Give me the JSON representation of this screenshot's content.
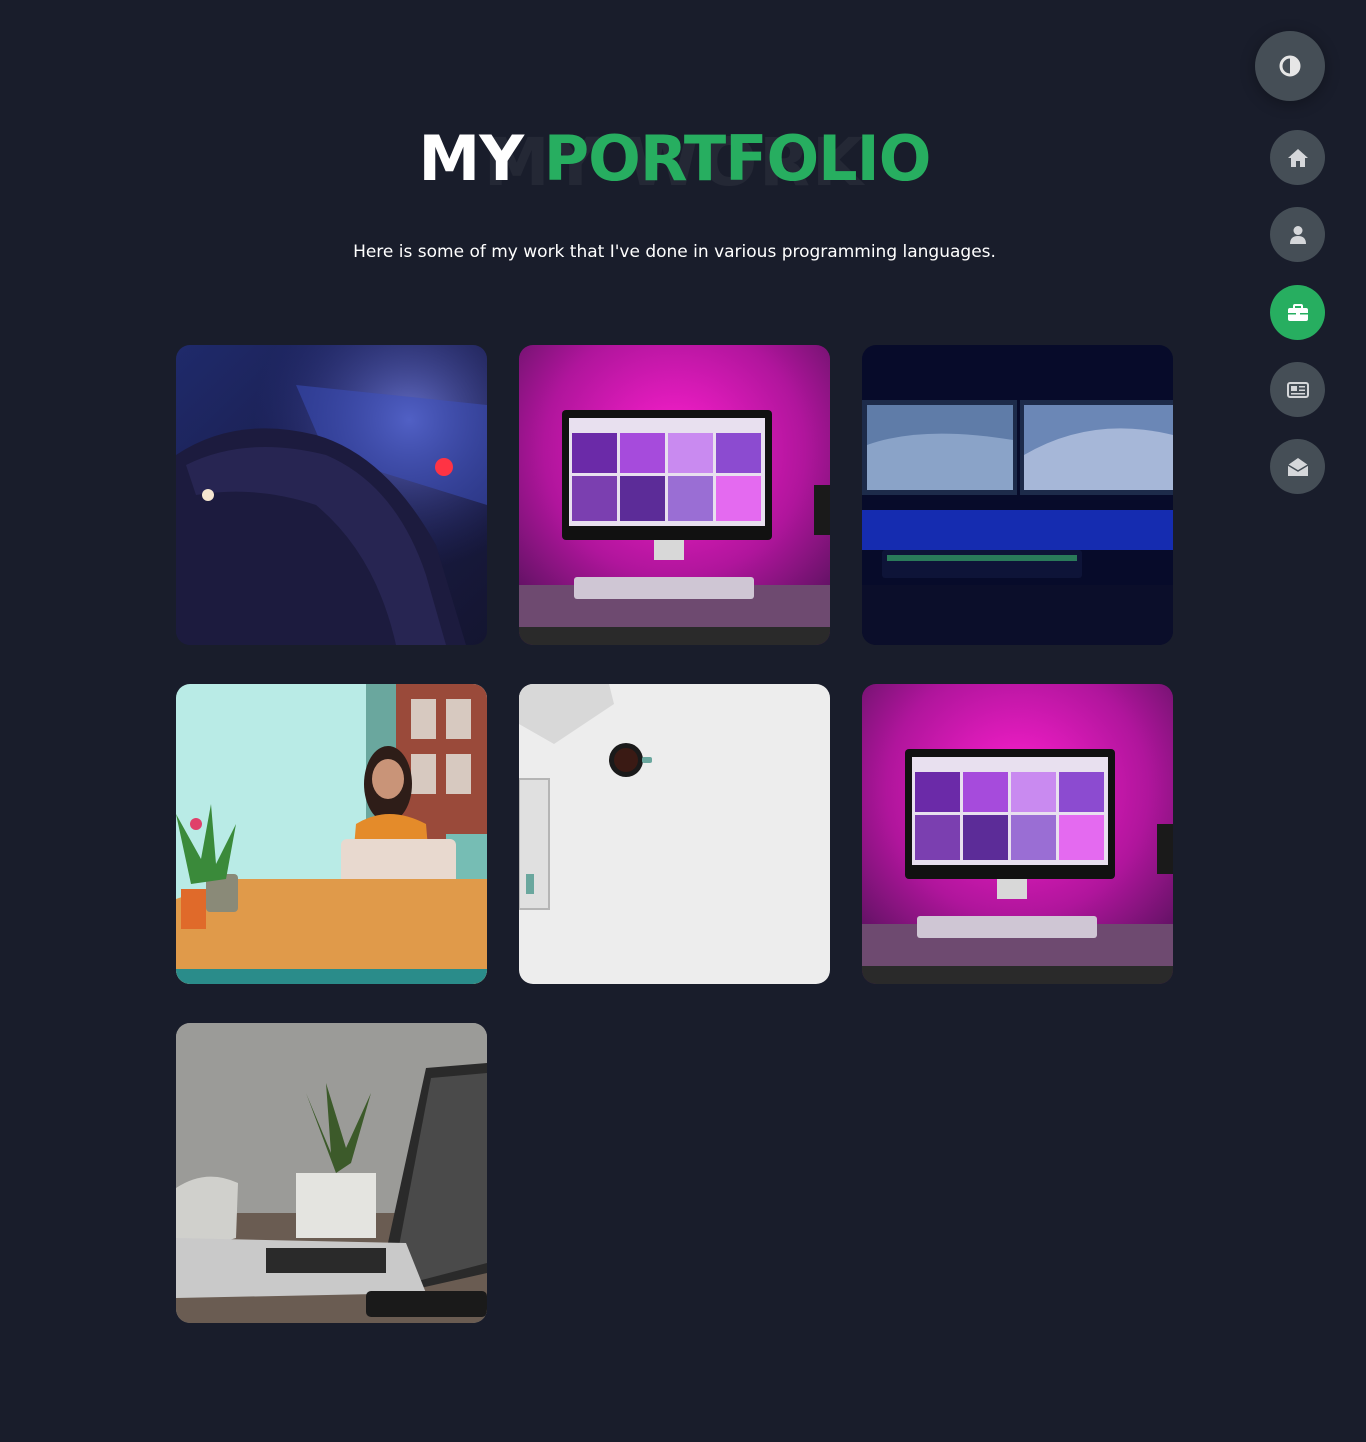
{
  "title": {
    "background_text": "MY WORK",
    "white_part": "MY",
    "green_part": "PORTFOLIO"
  },
  "subtitle": "Here is some of my work that I've done in various programming languages.",
  "colors": {
    "background": "#191d2b",
    "accent": "#27ae60",
    "button": "#454e56"
  },
  "controls": {
    "theme_toggle_icon": "half-circle-contrast-icon",
    "nav_items": [
      {
        "name": "home",
        "icon": "home-icon",
        "active": false
      },
      {
        "name": "about",
        "icon": "user-icon",
        "active": false
      },
      {
        "name": "portfolio",
        "icon": "briefcase-icon",
        "active": true
      },
      {
        "name": "blogs",
        "icon": "newspaper-icon",
        "active": false
      },
      {
        "name": "contact",
        "icon": "envelope-open-icon",
        "active": false
      }
    ]
  },
  "portfolio_items": [
    {
      "image": "hand on backlit keyboard"
    },
    {
      "image": "pink-lit desk with monitor"
    },
    {
      "image": "dual monitor blue desk setup"
    },
    {
      "image": "woman using laptop at table"
    },
    {
      "image": "white desk with coffee cup"
    },
    {
      "image": "pink-lit desk with monitor"
    },
    {
      "image": "laptop with plant on desk"
    }
  ]
}
